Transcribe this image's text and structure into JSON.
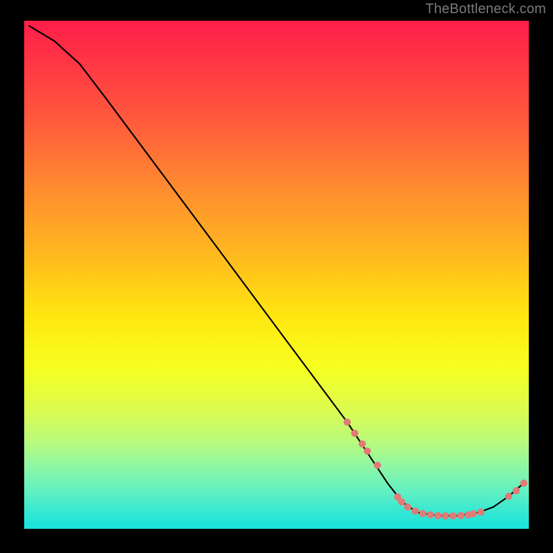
{
  "branding": {
    "watermark": "TheBottleneck.com"
  },
  "chart_data": {
    "type": "line",
    "title": "",
    "xlabel": "",
    "ylabel": "",
    "xlim": [
      0,
      100
    ],
    "ylim": [
      0,
      100
    ],
    "curve": [
      {
        "x": 1,
        "y": 99
      },
      {
        "x": 6,
        "y": 96
      },
      {
        "x": 11,
        "y": 91.5
      },
      {
        "x": 16,
        "y": 85
      },
      {
        "x": 28,
        "y": 69
      },
      {
        "x": 40,
        "y": 53
      },
      {
        "x": 52,
        "y": 37
      },
      {
        "x": 64,
        "y": 21
      },
      {
        "x": 68,
        "y": 15
      },
      {
        "x": 72,
        "y": 9
      },
      {
        "x": 75,
        "y": 5.2
      },
      {
        "x": 78,
        "y": 3.2
      },
      {
        "x": 82,
        "y": 2.6
      },
      {
        "x": 86,
        "y": 2.6
      },
      {
        "x": 90,
        "y": 3.2
      },
      {
        "x": 93,
        "y": 4.3
      },
      {
        "x": 96,
        "y": 6.4
      },
      {
        "x": 99,
        "y": 9.0
      }
    ],
    "markers": [
      {
        "x": 64.0,
        "y": 21.0
      },
      {
        "x": 65.5,
        "y": 18.8
      },
      {
        "x": 67.0,
        "y": 16.7
      },
      {
        "x": 68.0,
        "y": 15.3
      },
      {
        "x": 70.0,
        "y": 12.5
      },
      {
        "x": 74.0,
        "y": 6.3
      },
      {
        "x": 74.8,
        "y": 5.3
      },
      {
        "x": 76.0,
        "y": 4.3
      },
      {
        "x": 77.5,
        "y": 3.5
      },
      {
        "x": 79.0,
        "y": 3.0
      },
      {
        "x": 80.5,
        "y": 2.75
      },
      {
        "x": 82.0,
        "y": 2.6
      },
      {
        "x": 83.5,
        "y": 2.55
      },
      {
        "x": 85.0,
        "y": 2.55
      },
      {
        "x": 86.5,
        "y": 2.6
      },
      {
        "x": 88.0,
        "y": 2.75
      },
      {
        "x": 89.0,
        "y": 2.95
      },
      {
        "x": 90.5,
        "y": 3.3
      },
      {
        "x": 96.0,
        "y": 6.4
      },
      {
        "x": 97.5,
        "y": 7.5
      },
      {
        "x": 99.0,
        "y": 9.0
      }
    ],
    "marker_color": "#e27a77",
    "line_color": "#000000"
  }
}
